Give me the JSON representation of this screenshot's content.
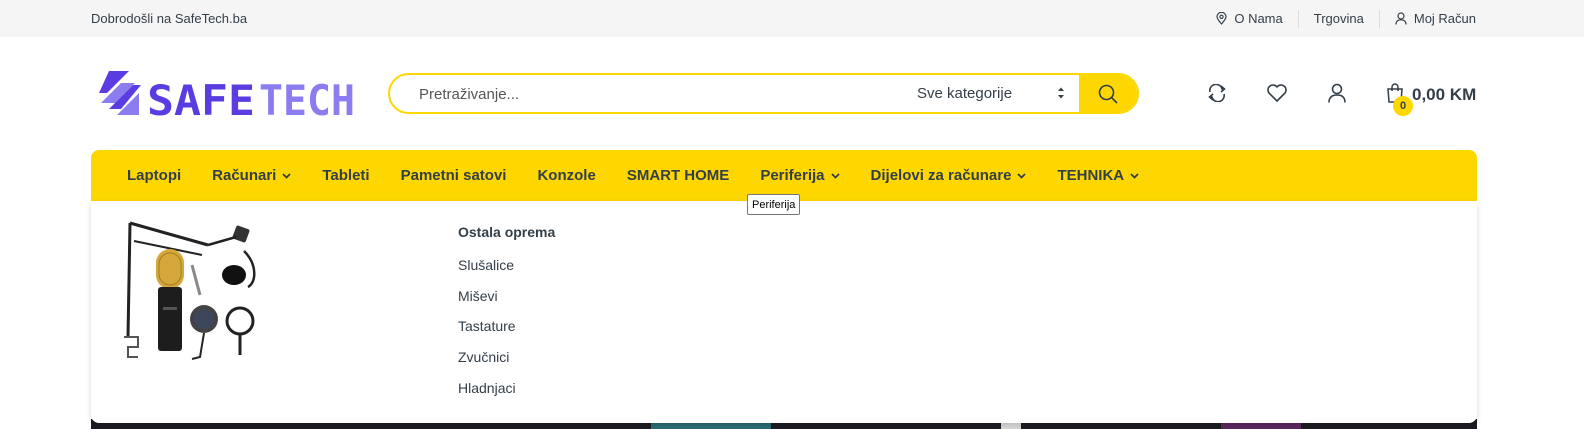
{
  "topbar": {
    "welcome": "Dobrodošli na SafeTech.ba",
    "links": [
      {
        "label": "O Nama",
        "icon": "location-pin-icon"
      },
      {
        "label": "Trgovina",
        "icon": ""
      },
      {
        "label": "Moj Račun",
        "icon": "user-icon"
      }
    ]
  },
  "brand": {
    "name": "SAFETECH",
    "color_primary": "#5b3ce0",
    "color_secondary": "#8b7cf0"
  },
  "search": {
    "placeholder": "Pretraživanje...",
    "category": "Sve kategorije",
    "accent": "#fed700"
  },
  "header_icons": [
    "compare-icon",
    "heart-icon",
    "account-icon"
  ],
  "cart": {
    "count": "0",
    "total": "0,00 KM"
  },
  "nav": {
    "items": [
      {
        "label": "Laptopi",
        "dropdown": false
      },
      {
        "label": "Računari",
        "dropdown": true
      },
      {
        "label": "Tableti",
        "dropdown": false
      },
      {
        "label": "Pametni satovi",
        "dropdown": false
      },
      {
        "label": "Konzole",
        "dropdown": false
      },
      {
        "label": "SMART HOME",
        "dropdown": false
      },
      {
        "label": "Periferija",
        "dropdown": true
      },
      {
        "label": "Dijelovi za računare",
        "dropdown": true
      },
      {
        "label": "TEHNIKA",
        "dropdown": true
      }
    ],
    "tooltip": "Periferija"
  },
  "megamenu": {
    "heading": "Ostala oprema",
    "items": [
      "Slušalice",
      "Miševi",
      "Tastature",
      "Zvučnici",
      "Hladnjaci"
    ]
  }
}
